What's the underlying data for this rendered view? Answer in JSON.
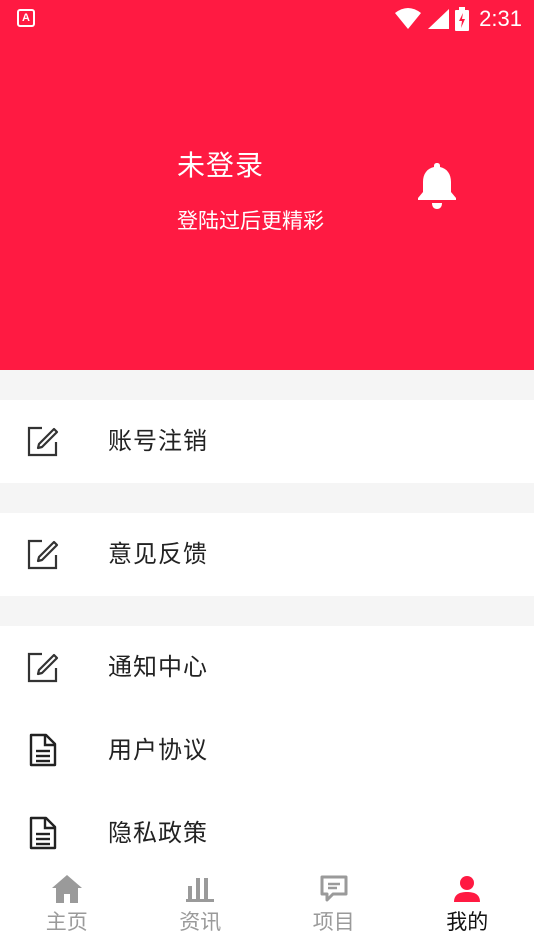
{
  "status_bar": {
    "app_icon_letter": "A",
    "time": "2:31"
  },
  "profile": {
    "title": "未登录",
    "subtitle": "登陆过后更精彩",
    "accent_color": "#ff1a42"
  },
  "menu": {
    "items": [
      {
        "label": "账号注销",
        "icon": "edit-icon"
      },
      {
        "label": "意见反馈",
        "icon": "edit-icon"
      },
      {
        "label": "通知中心",
        "icon": "edit-icon"
      },
      {
        "label": "用户协议",
        "icon": "document-icon"
      },
      {
        "label": "隐私政策",
        "icon": "document-icon"
      }
    ]
  },
  "tabbar": {
    "tabs": [
      {
        "label": "主页",
        "icon": "home-icon",
        "active": false
      },
      {
        "label": "资讯",
        "icon": "bar-chart-icon",
        "active": false
      },
      {
        "label": "项目",
        "icon": "chat-icon",
        "active": false
      },
      {
        "label": "我的",
        "icon": "person-icon",
        "active": true
      }
    ],
    "active_color": "#ff1a42",
    "inactive_color": "#9a9a9a"
  }
}
